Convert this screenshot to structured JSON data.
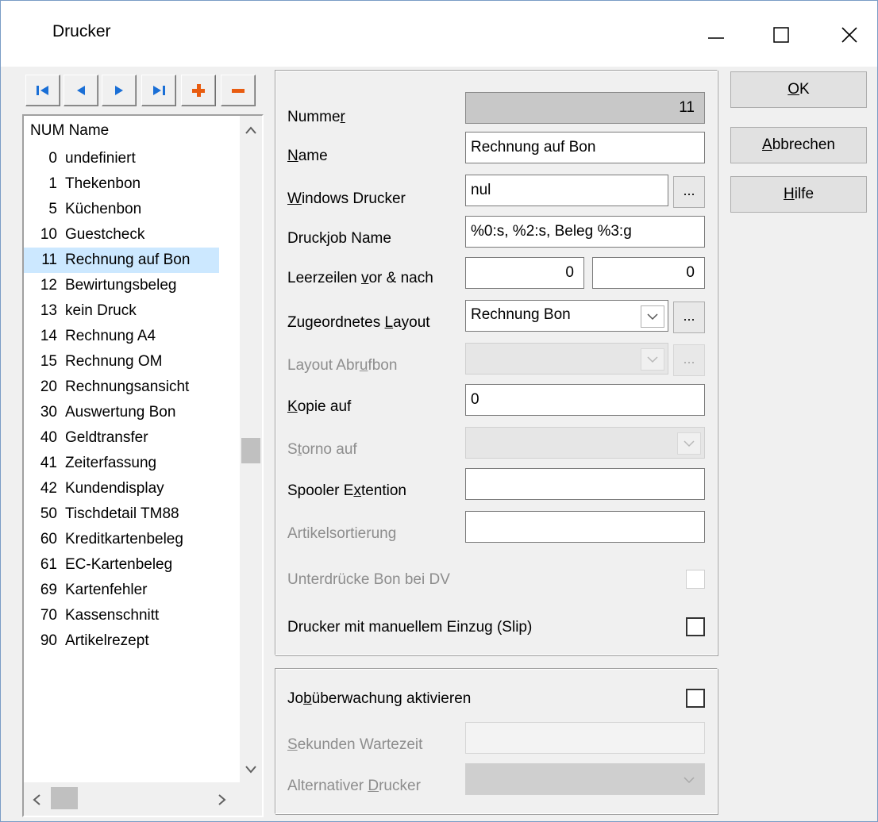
{
  "window": {
    "title": "Drucker"
  },
  "toolbar": {
    "first": "first-record",
    "prev": "previous-record",
    "next": "next-record",
    "last": "last-record",
    "add": "add-record",
    "remove": "delete-record"
  },
  "list": {
    "header_num": "NUM",
    "header_name": "Name",
    "items": [
      {
        "num": "0",
        "name": "undefiniert"
      },
      {
        "num": "1",
        "name": "Thekenbon"
      },
      {
        "num": "5",
        "name": "Küchenbon"
      },
      {
        "num": "10",
        "name": "Guestcheck"
      },
      {
        "num": "11",
        "name": "Rechnung auf Bon",
        "selected": true
      },
      {
        "num": "12",
        "name": "Bewirtungsbeleg"
      },
      {
        "num": "13",
        "name": "kein Druck"
      },
      {
        "num": "14",
        "name": "Rechnung A4"
      },
      {
        "num": "15",
        "name": "Rechnung OM"
      },
      {
        "num": "20",
        "name": "Rechnungsansicht"
      },
      {
        "num": "30",
        "name": "Auswertung Bon"
      },
      {
        "num": "40",
        "name": "Geldtransfer"
      },
      {
        "num": "41",
        "name": "Zeiterfassung"
      },
      {
        "num": "42",
        "name": "Kundendisplay"
      },
      {
        "num": "50",
        "name": "Tischdetail TM88"
      },
      {
        "num": "60",
        "name": "Kreditkartenbeleg"
      },
      {
        "num": "61",
        "name": "EC-Kartenbeleg"
      },
      {
        "num": "69",
        "name": "Kartenfehler"
      },
      {
        "num": "70",
        "name": "Kassenschnitt"
      },
      {
        "num": "90",
        "name": "Artikelrezept"
      }
    ]
  },
  "form": {
    "nummer": {
      "label_pre": "Numme",
      "label_key": "r",
      "label_post": "",
      "value": "11"
    },
    "name": {
      "label_pre": "",
      "label_key": "N",
      "label_post": "ame",
      "value": "Rechnung auf Bon"
    },
    "windows_drucker": {
      "label_pre": "",
      "label_key": "W",
      "label_post": "indows Drucker",
      "value": "nul",
      "browse": "..."
    },
    "druckjob": {
      "label": "Druckjob Name",
      "value": "%0:s, %2:s, Beleg %3:g"
    },
    "leerzeilen": {
      "label_pre": "Leerzeilen ",
      "label_key": "v",
      "label_post": "or & nach",
      "vor": "0",
      "nach": "0"
    },
    "layout": {
      "label_pre": "Zugeordnetes ",
      "label_key": "L",
      "label_post": "ayout",
      "value": "Rechnung Bon",
      "browse": "..."
    },
    "layout_abruf": {
      "label_pre": "Layout Abr",
      "label_key": "u",
      "label_post": "fbon",
      "value": "",
      "browse": "..."
    },
    "kopie": {
      "label_pre": "",
      "label_key": "K",
      "label_post": "opie auf",
      "value": "0"
    },
    "storno": {
      "label_pre": "S",
      "label_key": "t",
      "label_post": "orno auf",
      "value": ""
    },
    "spooler": {
      "label_pre": "Spooler E",
      "label_key": "x",
      "label_post": "tention",
      "value": ""
    },
    "artikelsortierung": {
      "label": "Artikelsortierung",
      "value": ""
    },
    "unterdruecke": {
      "label": "Unterdrücke Bon bei DV",
      "checked": false
    },
    "slip": {
      "label": "Drucker mit manuellem Einzug (Slip)",
      "checked": false
    }
  },
  "job": {
    "aktivieren": {
      "label_pre": "Jo",
      "label_key": "b",
      "label_post": "überwachung aktivieren",
      "checked": false
    },
    "sekunden": {
      "label_pre": "",
      "label_key": "S",
      "label_post": "ekunden Wartezeit",
      "value": ""
    },
    "alternativ": {
      "label_pre": "Alternativer ",
      "label_key": "D",
      "label_post": "rucker",
      "value": ""
    }
  },
  "buttons": {
    "ok": {
      "key": "O",
      "rest": "K"
    },
    "abbrechen": {
      "key": "A",
      "rest": "bbrechen"
    },
    "hilfe": {
      "key": "H",
      "rest": "ilfe"
    }
  },
  "colors": {
    "selection": "#cce8ff",
    "nav_blue": "#1a6fd6",
    "nav_orange": "#e85c10"
  }
}
